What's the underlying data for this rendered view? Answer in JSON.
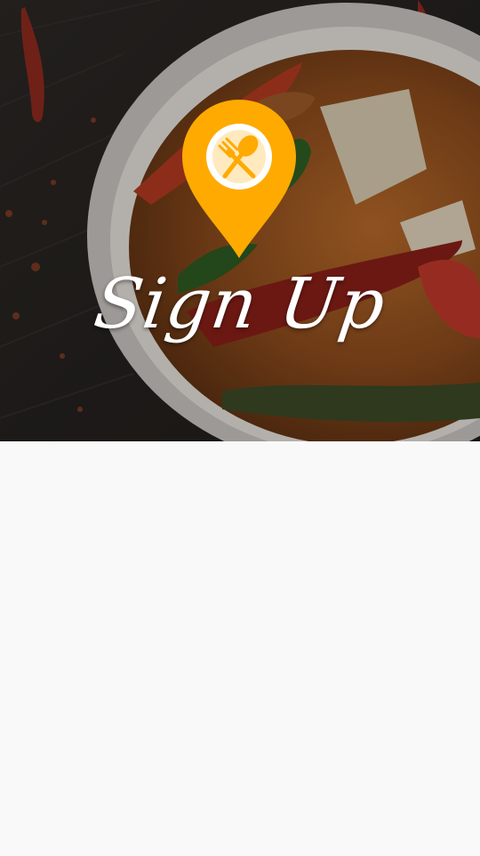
{
  "header": {
    "title": "Sign Up",
    "logo_icon": "map-pin-fork-spoon-icon",
    "hero_image": "thai-curry-bowl",
    "colors": {
      "pin": "#FFAA00",
      "title": "#FFFFFF",
      "background": "#F9F9F9"
    }
  }
}
